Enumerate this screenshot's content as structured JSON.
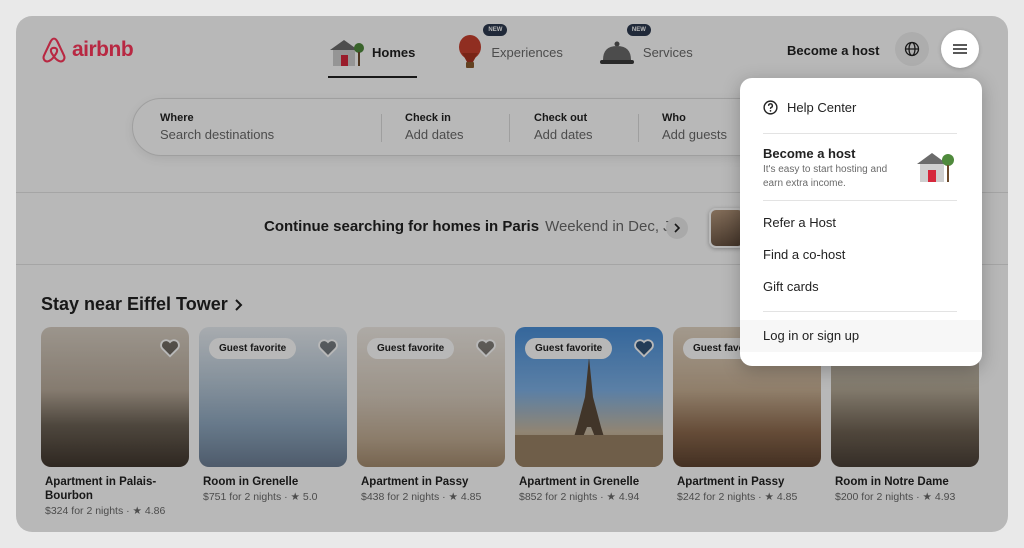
{
  "brand": {
    "name": "airbnb",
    "color": "#ff385c"
  },
  "nav": {
    "tabs": [
      {
        "label": "Homes",
        "icon": "house-icon",
        "badge": ""
      },
      {
        "label": "Experiences",
        "icon": "hot-air-balloon-icon",
        "badge": "NEW"
      },
      {
        "label": "Services",
        "icon": "service-bell-icon",
        "badge": "NEW"
      }
    ],
    "become_host": "Become a host"
  },
  "search": {
    "where": {
      "title": "Where",
      "value": "Search destinations"
    },
    "checkin": {
      "title": "Check in",
      "value": "Add dates"
    },
    "checkout": {
      "title": "Check out",
      "value": "Add dates"
    },
    "who": {
      "title": "Who",
      "value": "Add guests"
    }
  },
  "continue_search": {
    "title": "Continue searching for homes in Paris",
    "subtitle": "Weekend in Dec, Jun"
  },
  "section": {
    "title": "Stay near Eiffel Tower"
  },
  "listings": [
    {
      "name": "Apartment in Palais-Bourbon",
      "meta": "$324 for 2 nights · ★ 4.86",
      "badge": ""
    },
    {
      "name": "Room in Grenelle",
      "meta": "$751 for 2 nights · ★ 5.0",
      "badge": "Guest favorite"
    },
    {
      "name": "Apartment in Passy",
      "meta": "$438 for 2 nights · ★ 4.85",
      "badge": "Guest favorite"
    },
    {
      "name": "Apartment in Grenelle",
      "meta": "$852 for 2 nights · ★ 4.94",
      "badge": "Guest favorite"
    },
    {
      "name": "Apartment in Passy",
      "meta": "$242 for 2 nights · ★ 4.85",
      "badge": "Guest favo"
    },
    {
      "name": "Room in Notre Dame",
      "meta": "$200 for 2 nights · ★ 4.93",
      "badge": ""
    }
  ],
  "menu": {
    "help_center": "Help Center",
    "become_host_title": "Become a host",
    "become_host_sub": "It's easy to start hosting and earn extra income.",
    "refer_host": "Refer a Host",
    "find_cohost": "Find a co-host",
    "gift_cards": "Gift cards",
    "login": "Log in or sign up"
  }
}
